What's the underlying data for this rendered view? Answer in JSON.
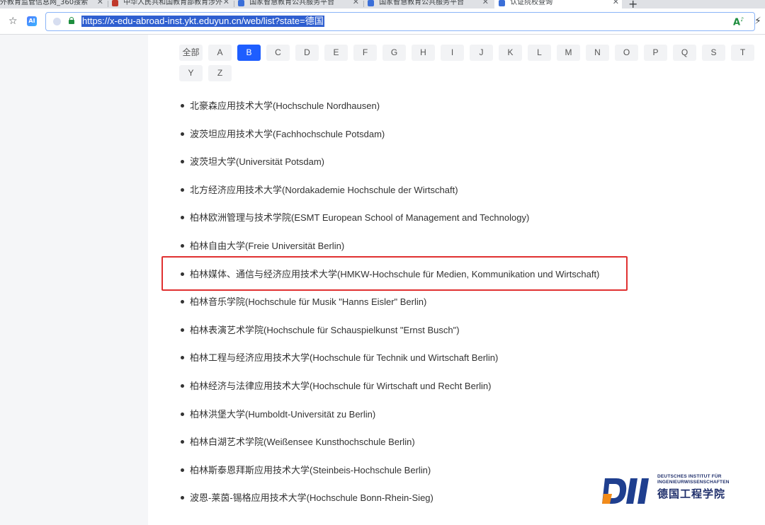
{
  "browser": {
    "tabs": [
      {
        "title": "外教育监管信息网_360搜索"
      },
      {
        "title": "中华人民共和国教育部教育涉外"
      },
      {
        "title": "国家智慧教育公共服务平台"
      },
      {
        "title": "国家智慧教育公共服务平台"
      },
      {
        "title": "认证院校查询"
      }
    ],
    "new_tab": "+",
    "url": "https://x-edu-abroad-inst.ykt.eduyun.cn/web/list?state=德国",
    "ai_label": "AI"
  },
  "letters": [
    "全部",
    "A",
    "B",
    "C",
    "D",
    "E",
    "F",
    "G",
    "H",
    "I",
    "J",
    "K",
    "L",
    "M",
    "N",
    "O",
    "P",
    "Q",
    "S",
    "T",
    "Y",
    "Z"
  ],
  "active_letter": "B",
  "schools": [
    "北豪森应用技术大学(Hochschule Nordhausen)",
    "波茨坦应用技术大学(Fachhochschule Potsdam)",
    "波茨坦大学(Universität Potsdam)",
    "北方经济应用技术大学(Nordakademie Hochschule der Wirtschaft)",
    "柏林欧洲管理与技术学院(ESMT European School of Management and Technology)",
    "柏林自由大学(Freie Universität Berlin)",
    "柏林媒体、通信与经济应用技术大学(HMKW-Hochschule für Medien, Kommunikation und Wirtschaft)",
    "柏林音乐学院(Hochschule für Musik \"Hanns Eisler\" Berlin)",
    "柏林表演艺术学院(Hochschule für Schauspielkunst \"Ernst Busch\")",
    "柏林工程与经济应用技术大学(Hochschule für Technik und Wirtschaft Berlin)",
    "柏林经济与法律应用技术大学(Hochschule für Wirtschaft und Recht Berlin)",
    "柏林洪堡大学(Humboldt-Universität zu Berlin)",
    "柏林白湖艺术学院(Weißensee Kunsthochschule Berlin)",
    "柏林斯泰恩拜斯应用技术大学(Steinbeis-Hochschule Berlin)",
    "波恩-莱茵-锡格应用技术大学(Hochschule Bonn-Rhein-Sieg)"
  ],
  "logo": {
    "en_line1": "DEUTSCHES INSTITUT FÜR",
    "en_line2": "INGENIEURWISSENSCHAFTEN",
    "cn": "德国工程学院"
  }
}
